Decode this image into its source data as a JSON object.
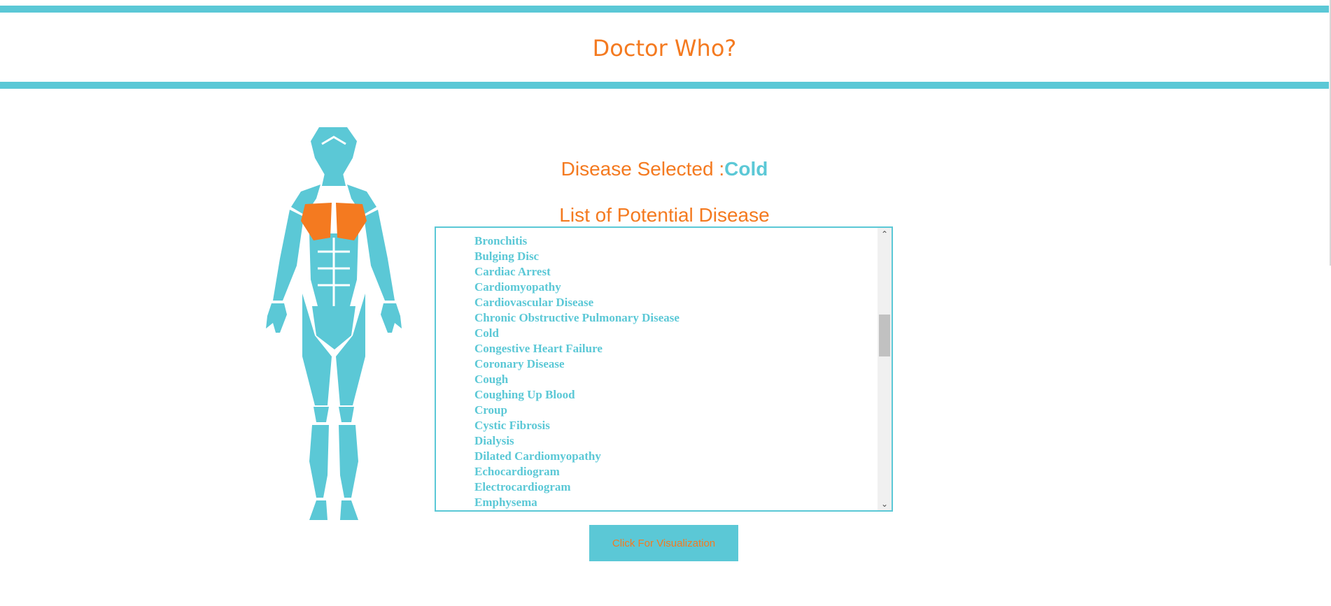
{
  "app": {
    "title": "Doctor Who?"
  },
  "selection": {
    "label": "Disease Selected :",
    "value": "Cold"
  },
  "list": {
    "heading": "List of Potential Disease",
    "items": [
      "Bronchitis",
      "Bulging Disc",
      "Cardiac Arrest",
      "Cardiomyopathy",
      "Cardiovascular Disease",
      "Chronic Obstructive Pulmonary Disease",
      "Cold",
      "Congestive Heart Failure",
      "Coronary Disease",
      "Cough",
      "Coughing Up Blood",
      "Croup",
      "Cystic Fibrosis",
      "Dialysis",
      "Dilated Cardiomyopathy",
      "Echocardiogram",
      "Electrocardiogram",
      "Emphysema"
    ]
  },
  "actions": {
    "visualize_label": "Click For Visualization"
  },
  "body_map": {
    "highlighted_region": "chest"
  },
  "colors": {
    "accent": "#5bc8d6",
    "brand": "#f47a20",
    "highlight": "#f47a20"
  },
  "icons": {
    "scroll_up": "chevron-up-icon",
    "scroll_down": "chevron-down-icon"
  }
}
